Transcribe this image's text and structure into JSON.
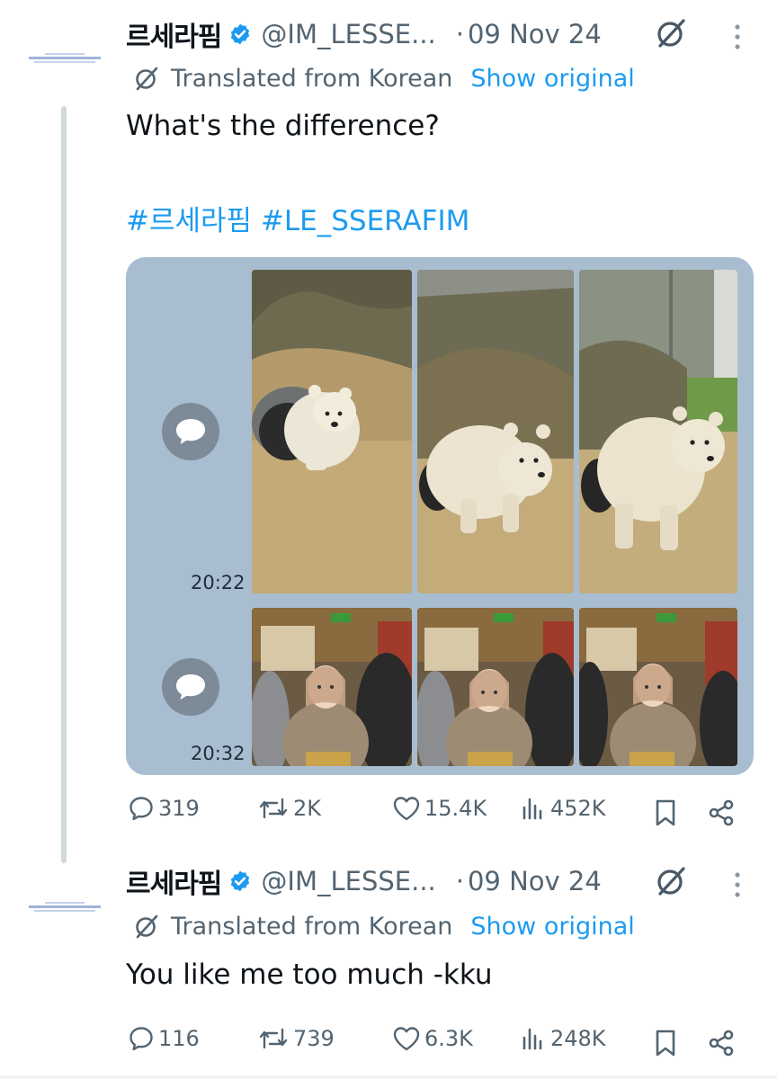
{
  "tweets": [
    {
      "author": {
        "name": "르세라핌",
        "handle": "@IM_LESSE...",
        "verified": true
      },
      "separator": "·",
      "date": "09 Nov 24",
      "translation": {
        "label": "Translated from Korean",
        "show_original": "Show original"
      },
      "text": "What's the difference?",
      "hashtags": "#르세라핌 #LE_SSERAFIM",
      "quote_rows": [
        {
          "time": "20:22",
          "thumbnails": [
            "polar bear emerging from den",
            "polar bear walking forward",
            "polar bear standing"
          ]
        },
        {
          "time": "20:32",
          "thumbnails": [
            "woman in cardigan at restaurant",
            "woman in cardigan looking down",
            "woman in cardigan smiling"
          ]
        }
      ],
      "stats": {
        "replies": "319",
        "reposts": "2K",
        "likes": "15.4K",
        "views": "452K"
      }
    },
    {
      "author": {
        "name": "르세라핌",
        "handle": "@IM_LESSE...",
        "verified": true
      },
      "separator": "·",
      "date": "09 Nov 24",
      "translation": {
        "label": "Translated from Korean",
        "show_original": "Show original"
      },
      "text": "You like me too much -kku",
      "stats": {
        "replies": "116",
        "reposts": "739",
        "likes": "6.3K",
        "views": "248K"
      }
    }
  ],
  "icons": [
    "verified-badge-icon",
    "grok-icon",
    "more-icon",
    "translate-icon",
    "reply-icon",
    "repost-icon",
    "like-icon",
    "views-icon",
    "bookmark-icon",
    "share-icon",
    "chat-bubble-icon"
  ],
  "colors": {
    "accent": "#1d9bf0",
    "muted": "#536471",
    "text": "#0f1419",
    "quote_bg": "#a9bdd0"
  }
}
